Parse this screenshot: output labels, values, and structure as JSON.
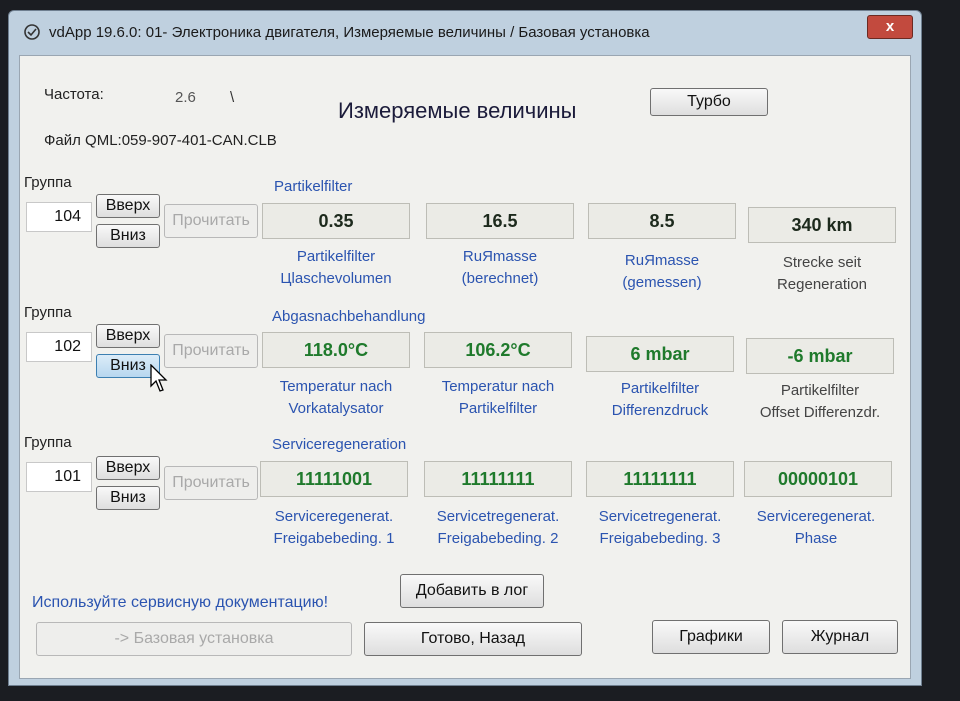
{
  "window": {
    "title": "vdApp 19.6.0: 01- Электроника двигателя,  Измеряемые величины / Базовая установка",
    "close": "x"
  },
  "header": {
    "freq_label": "Частота:",
    "freq_value": "2.6",
    "freq_indicator": "\\",
    "title": "Измеряемые величины",
    "turbo_button": "Турбо",
    "file_line": "Файл QML:059-907-401-CAN.CLB"
  },
  "groups": [
    {
      "group_label": "Группа",
      "number": "104",
      "up": "Вверх",
      "down": "Вниз",
      "read": "Прочитать",
      "name": "Partikelfilter",
      "cells": [
        {
          "value": "0.35",
          "cap1": "Partikelfilter",
          "cap2": "Цlaschevolumen"
        },
        {
          "value": "16.5",
          "cap1": "RuЯmasse",
          "cap2": "(berechnet)"
        },
        {
          "value": "8.5",
          "cap1": "RuЯmasse",
          "cap2": "(gemessen)"
        },
        {
          "value": "340 km",
          "cap1": "Strecke seit",
          "cap2": "Regeneration"
        }
      ]
    },
    {
      "group_label": "Группа",
      "number": "102",
      "up": "Вверх",
      "down": "Вниз",
      "read": "Прочитать",
      "name": "Abgasnachbehandlung",
      "cells": [
        {
          "value": "118.0°C",
          "cap1": "Temperatur nach",
          "cap2": "Vorkatalysator"
        },
        {
          "value": "106.2°C",
          "cap1": "Temperatur nach",
          "cap2": "Partikelfilter"
        },
        {
          "value": "6 mbar",
          "cap1": "Partikelfilter",
          "cap2": "Differenzdruck"
        },
        {
          "value": "-6 mbar",
          "cap1": "Partikelfilter",
          "cap2": "Offset Differenzdr."
        }
      ]
    },
    {
      "group_label": "Группа",
      "number": "101",
      "up": "Вверх",
      "down": "Вниз",
      "read": "Прочитать",
      "name": "Serviceregeneration",
      "cells": [
        {
          "value": "11111001",
          "cap1": "Serviceregenerat.",
          "cap2": "Freigabebeding. 1"
        },
        {
          "value": "11111111",
          "cap1": "Servicetregenerat.",
          "cap2": "Freigabebeding. 2"
        },
        {
          "value": "11111111",
          "cap1": "Servicetregenerat.",
          "cap2": "Freigabebeding. 3"
        },
        {
          "value": "00000101",
          "cap1": "Serviceregenerat.",
          "cap2": "Phase"
        }
      ]
    }
  ],
  "footer": {
    "hint": "Используйте сервисную документацию!",
    "add_log": "Добавить в лог",
    "basic_setting": "-> Базовая установка",
    "done_back": "Готово, Назад",
    "graphs": "Графики",
    "journal": "Журнал"
  },
  "colors": {
    "value_green": "#1f7a2c",
    "caption_blue": "#2b54b0",
    "window_frame": "#bfd0df",
    "close_red": "#c24a3e"
  }
}
